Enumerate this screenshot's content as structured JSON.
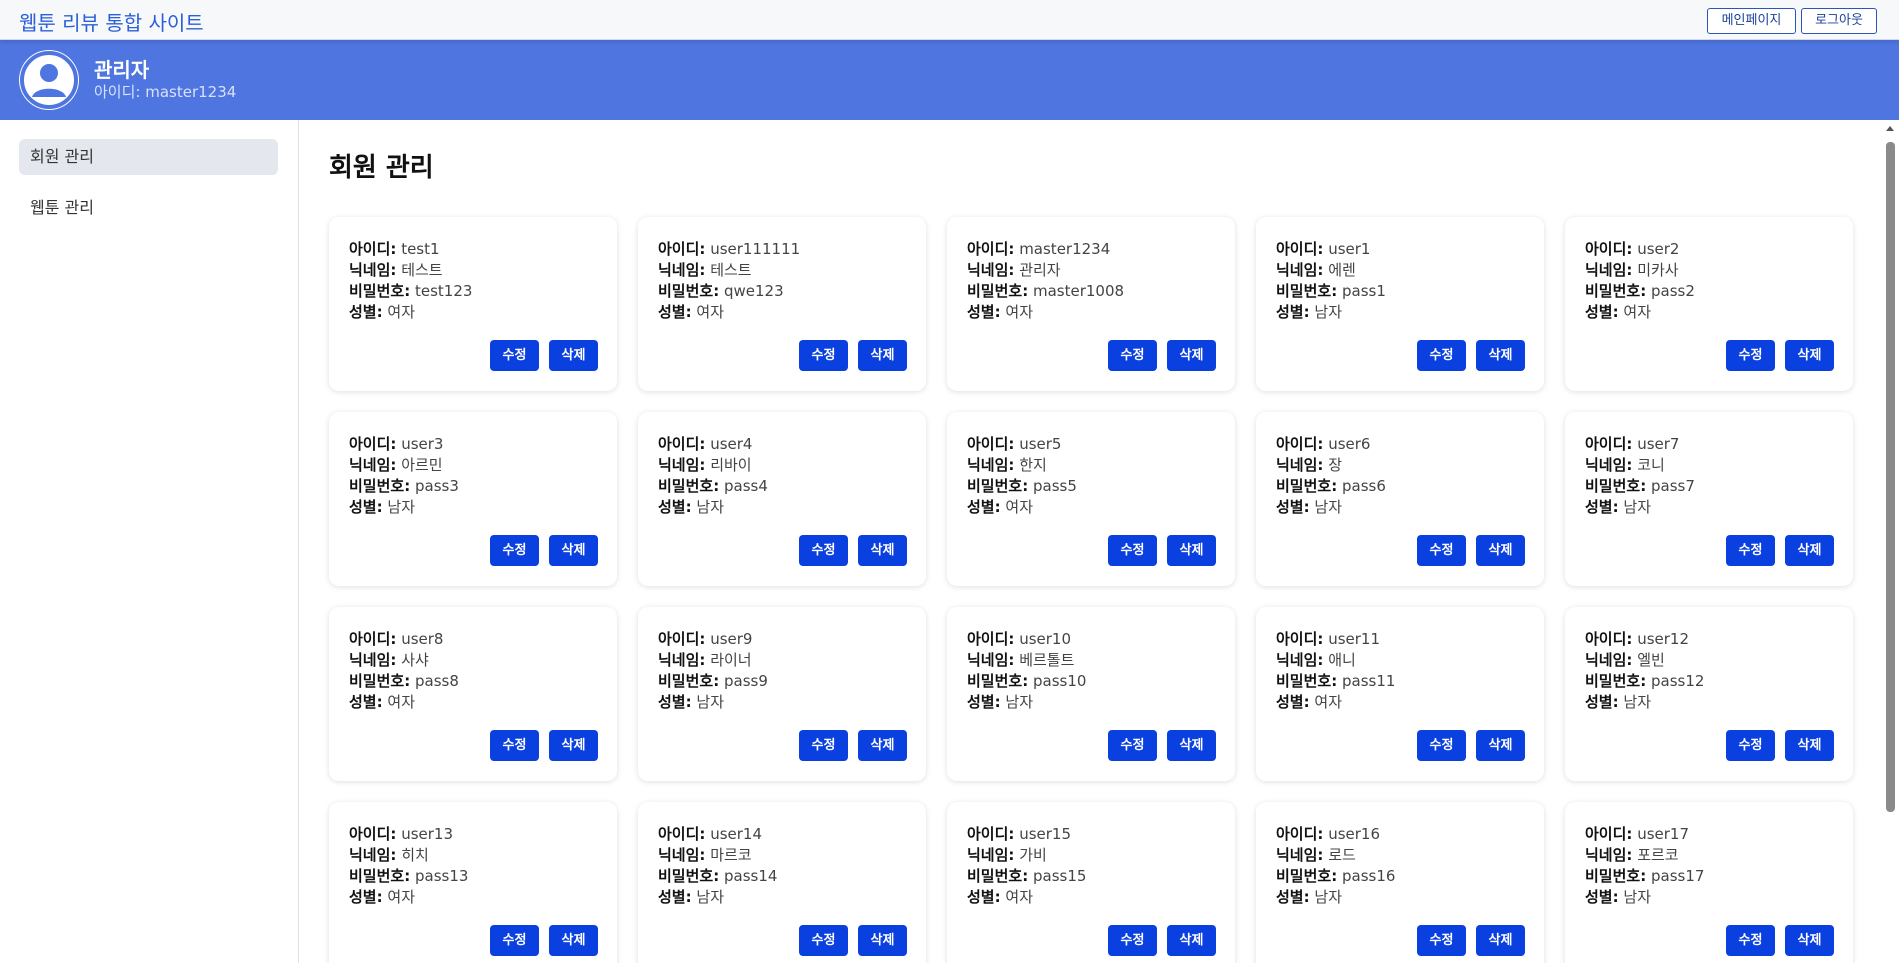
{
  "site_title": "웹툰 리뷰 통합 사이트",
  "top_buttons": {
    "main_page": "메인페이지",
    "logout": "로그아웃"
  },
  "profile": {
    "name": "관리자",
    "id_line": "아이디: master1234"
  },
  "sidebar": {
    "items": [
      {
        "label": "회원 관리",
        "active": true
      },
      {
        "label": "웹툰 관리",
        "active": false
      }
    ]
  },
  "page_title": "회원 관리",
  "field_labels": {
    "id": "아이디:",
    "nickname": "닉네임:",
    "password": "비밀번호:",
    "gender": "성별:"
  },
  "button_labels": {
    "edit": "수정",
    "delete": "삭제"
  },
  "colors": {
    "accent": "#4f75e0",
    "button": "#0a3fe0",
    "title": "#2b5fd9"
  },
  "members": [
    {
      "id": "test1",
      "nickname": "테스트",
      "password": "test123",
      "gender": "여자"
    },
    {
      "id": "user111111",
      "nickname": "테스트",
      "password": "qwe123",
      "gender": "여자"
    },
    {
      "id": "master1234",
      "nickname": "관리자",
      "password": "master1008",
      "gender": "여자"
    },
    {
      "id": "user1",
      "nickname": "에렌",
      "password": "pass1",
      "gender": "남자"
    },
    {
      "id": "user2",
      "nickname": "미카사",
      "password": "pass2",
      "gender": "여자"
    },
    {
      "id": "user3",
      "nickname": "아르민",
      "password": "pass3",
      "gender": "남자"
    },
    {
      "id": "user4",
      "nickname": "리바이",
      "password": "pass4",
      "gender": "남자"
    },
    {
      "id": "user5",
      "nickname": "한지",
      "password": "pass5",
      "gender": "여자"
    },
    {
      "id": "user6",
      "nickname": "장",
      "password": "pass6",
      "gender": "남자"
    },
    {
      "id": "user7",
      "nickname": "코니",
      "password": "pass7",
      "gender": "남자"
    },
    {
      "id": "user8",
      "nickname": "사샤",
      "password": "pass8",
      "gender": "여자"
    },
    {
      "id": "user9",
      "nickname": "라이너",
      "password": "pass9",
      "gender": "남자"
    },
    {
      "id": "user10",
      "nickname": "베르톨트",
      "password": "pass10",
      "gender": "남자"
    },
    {
      "id": "user11",
      "nickname": "애니",
      "password": "pass11",
      "gender": "여자"
    },
    {
      "id": "user12",
      "nickname": "엘빈",
      "password": "pass12",
      "gender": "남자"
    },
    {
      "id": "user13",
      "nickname": "히치",
      "password": "pass13",
      "gender": "여자"
    },
    {
      "id": "user14",
      "nickname": "마르코",
      "password": "pass14",
      "gender": "남자"
    },
    {
      "id": "user15",
      "nickname": "가비",
      "password": "pass15",
      "gender": "여자"
    },
    {
      "id": "user16",
      "nickname": "로드",
      "password": "pass16",
      "gender": "남자"
    },
    {
      "id": "user17",
      "nickname": "포르코",
      "password": "pass17",
      "gender": "남자"
    }
  ]
}
